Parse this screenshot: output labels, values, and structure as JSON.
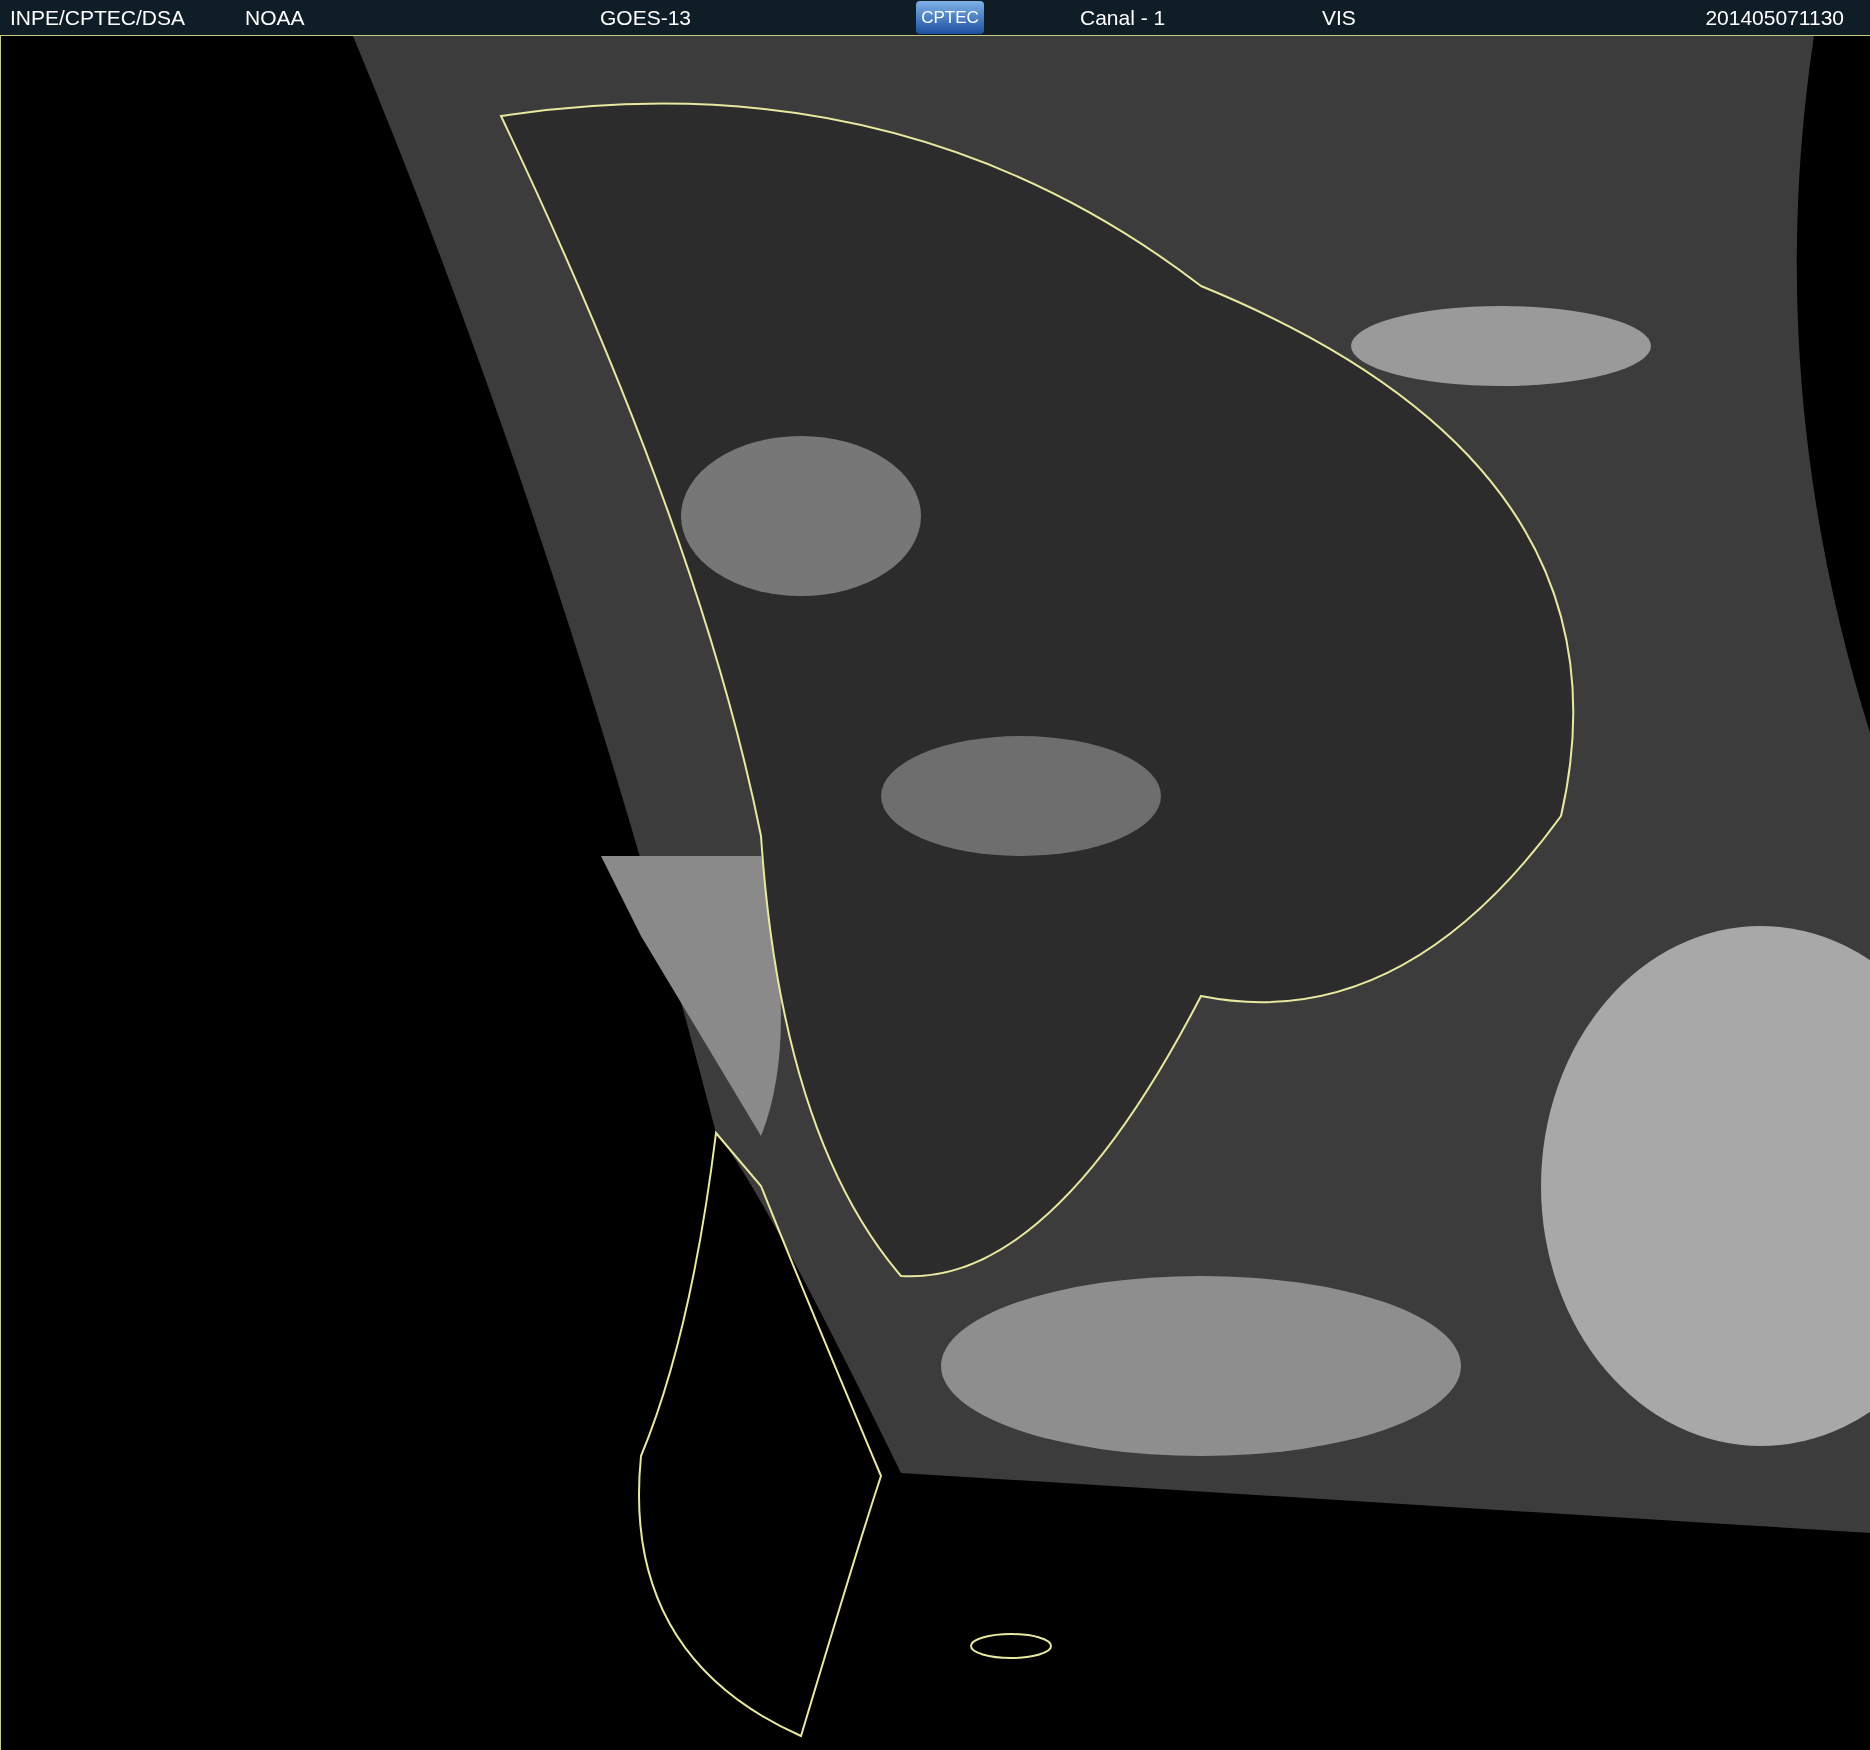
{
  "header": {
    "source": "INPE/CPTEC/DSA",
    "agency": "NOAA",
    "satellite": "GOES-13",
    "logo": "CPTEC",
    "channel": "Canal - 1",
    "band": "VIS",
    "timestamp": "201405071130"
  }
}
